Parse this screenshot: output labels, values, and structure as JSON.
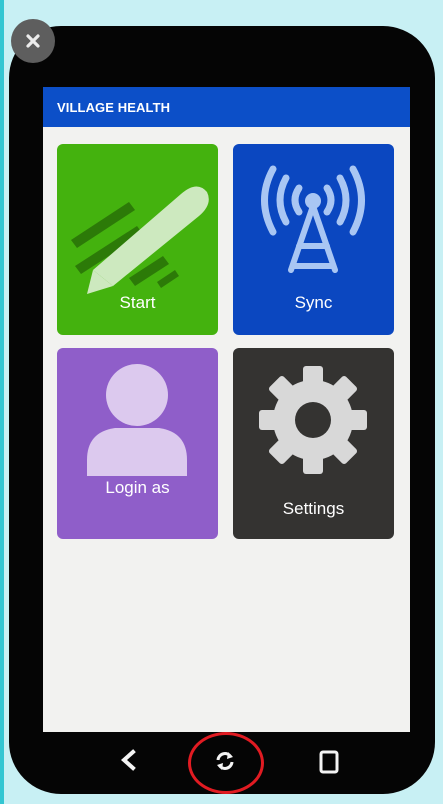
{
  "app": {
    "title": "VILLAGE HEALTH"
  },
  "tiles": [
    {
      "label": "Start",
      "color": "#44b20e",
      "icon": "pencil-icon"
    },
    {
      "label": "Sync",
      "color": "#0b47c0",
      "icon": "antenna-icon"
    },
    {
      "label": "Login as",
      "color": "#8f5ec9",
      "icon": "person-icon"
    },
    {
      "label": "Settings",
      "color": "#343331",
      "icon": "gear-icon"
    }
  ],
  "nav": {
    "icons": [
      "back-icon",
      "refresh-icon",
      "tablet-icon"
    ]
  },
  "colors": {
    "header": "#0c4fc8",
    "screen_bg": "#f2f2f0",
    "phone_frame": "#050505",
    "highlight_ring": "#e11b22"
  }
}
